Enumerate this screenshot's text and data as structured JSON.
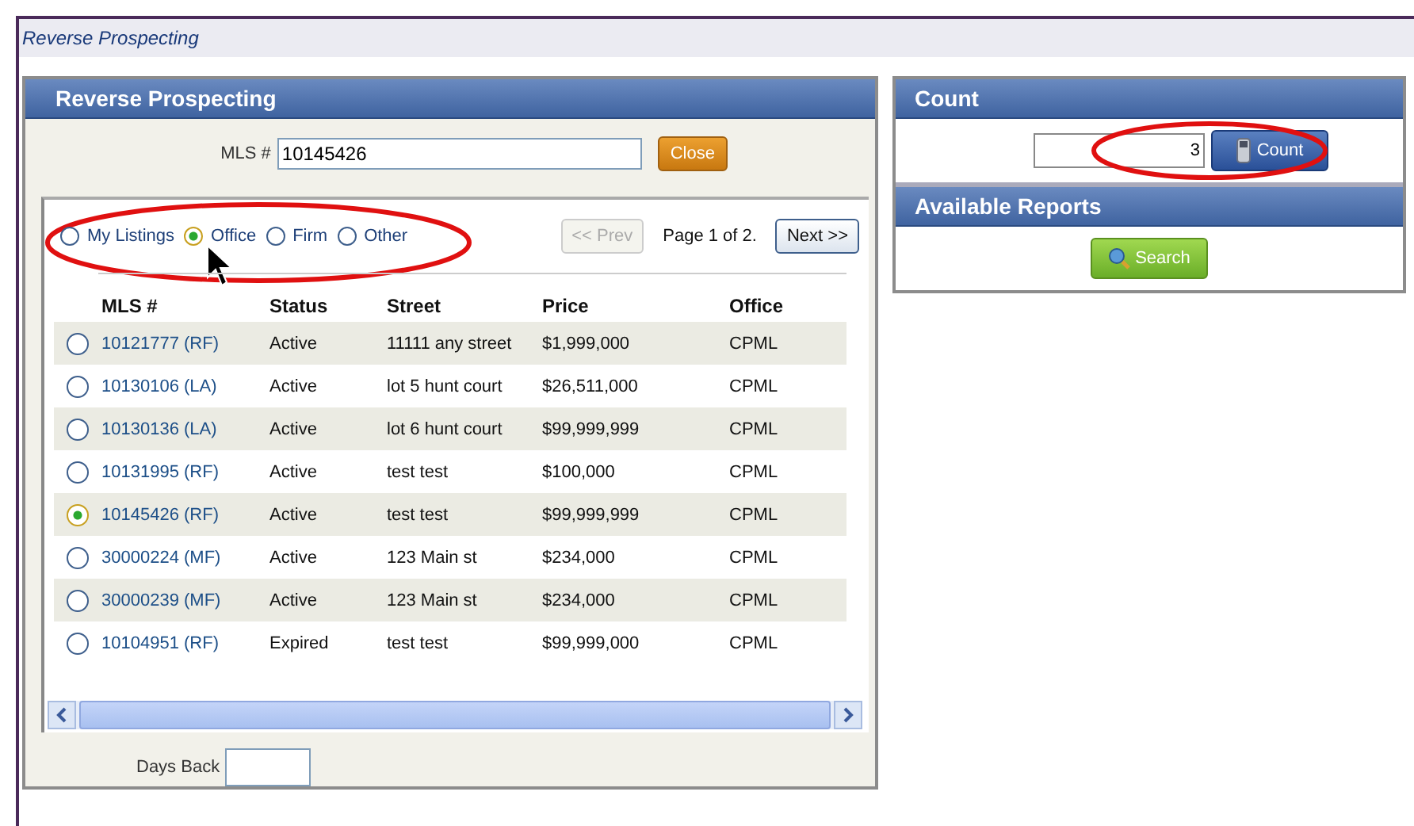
{
  "window": {
    "title": "Reverse Prospecting"
  },
  "left_panel": {
    "title": "Reverse Prospecting",
    "mls_field": {
      "label": "MLS #",
      "value": "10145426"
    },
    "close_button": "Close",
    "filters": [
      {
        "label": "My Listings",
        "selected": false
      },
      {
        "label": "Office",
        "selected": true
      },
      {
        "label": "Firm",
        "selected": false
      },
      {
        "label": "Other",
        "selected": false
      }
    ],
    "prev_button": {
      "label": "<< Prev",
      "disabled": true
    },
    "page_info": "Page 1 of 2.",
    "next_button": {
      "label": "Next >>",
      "disabled": false
    },
    "table": {
      "columns": [
        "MLS #",
        "Status",
        "Street",
        "Price",
        "Office"
      ],
      "rows": [
        {
          "selected": false,
          "mls": "10121777 (RF)",
          "status": "Active",
          "street": "11111 any street",
          "price": "$1,999,000",
          "office": "CPML"
        },
        {
          "selected": false,
          "mls": "10130106 (LA)",
          "status": "Active",
          "street": "lot 5 hunt court",
          "price": "$26,511,000",
          "office": "CPML"
        },
        {
          "selected": false,
          "mls": "10130136 (LA)",
          "status": "Active",
          "street": "lot 6 hunt court",
          "price": "$99,999,999",
          "office": "CPML"
        },
        {
          "selected": false,
          "mls": "10131995 (RF)",
          "status": "Active",
          "street": "test test",
          "price": "$100,000",
          "office": "CPML"
        },
        {
          "selected": true,
          "mls": "10145426 (RF)",
          "status": "Active",
          "street": "test test",
          "price": "$99,999,999",
          "office": "CPML"
        },
        {
          "selected": false,
          "mls": "30000224 (MF)",
          "status": "Active",
          "street": "123 Main st",
          "price": "$234,000",
          "office": "CPML"
        },
        {
          "selected": false,
          "mls": "30000239 (MF)",
          "status": "Active",
          "street": "123 Main st",
          "price": "$234,000",
          "office": "CPML"
        },
        {
          "selected": false,
          "mls": "10104951 (RF)",
          "status": "Expired",
          "street": "test test",
          "price": "$99,999,000",
          "office": "CPML"
        }
      ]
    },
    "days_back": {
      "label": "Days Back"
    }
  },
  "count_panel": {
    "title": "Count",
    "value": "3",
    "button": "Count"
  },
  "reports_panel": {
    "title": "Available Reports",
    "button": "Search"
  }
}
